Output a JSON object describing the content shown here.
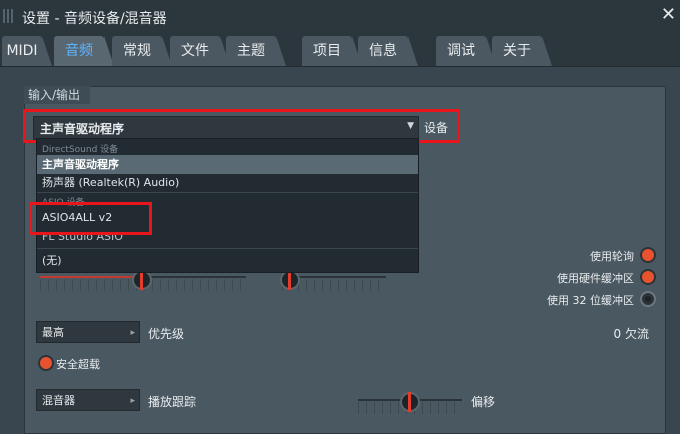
{
  "window": {
    "title": "设置 - 音频设备/混音器",
    "close_icon": "close-icon"
  },
  "tabs": [
    {
      "label": "MIDI",
      "active": false
    },
    {
      "label": "音频",
      "active": true
    },
    {
      "label": "常规",
      "active": false
    },
    {
      "label": "文件",
      "active": false
    },
    {
      "label": "主题",
      "active": false
    },
    {
      "label": "项目",
      "active": false
    },
    {
      "label": "信息",
      "active": false
    },
    {
      "label": "调试",
      "active": false
    },
    {
      "label": "关于",
      "active": false
    }
  ],
  "io_section": {
    "label": "输入/输出",
    "device_dropdown_value": "主声音驱动程序",
    "device_label": "设备"
  },
  "device_list": {
    "group_directsound": "DirectSound 设备",
    "item_primary": "主声音驱动程序",
    "item_speaker": "扬声器 (Realtek(R) Audio)",
    "group_asio": "ASIO 设备",
    "item_asio4all": "ASIO4ALL v2",
    "item_fl_asio": "FL Studio ASIO",
    "item_none": "(无)"
  },
  "options": {
    "polling": "使用轮询",
    "hw_buffer": "使用硬件缓冲区",
    "bit32_buffer": "使用 32 位缓冲区"
  },
  "priority": {
    "dropdown_value": "最高",
    "label": "优先级",
    "underruns": "0 欠流"
  },
  "safe_overload": {
    "label": "安全超载"
  },
  "mixer": {
    "dropdown_value": "混音器",
    "label": "播放跟踪",
    "offset_label": "偏移"
  },
  "colors": {
    "accent": "#5fb4ff",
    "highlight_red": "#e8161b",
    "radio_on": "#e9522f"
  }
}
